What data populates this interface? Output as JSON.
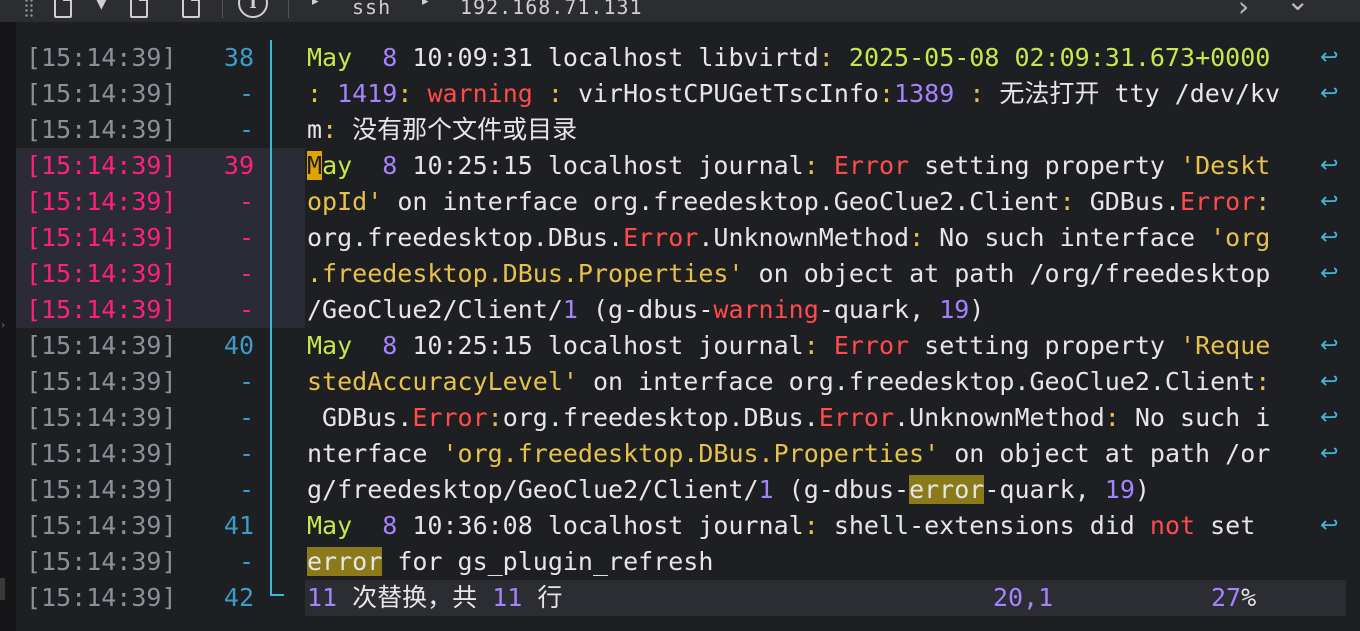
{
  "toolbar": {
    "caret_icon": "triangle-down",
    "info_label": "i",
    "path_arrow_1": "▸",
    "path_seg_1": "ssh",
    "path_arrow_2": "▸",
    "path_seg_2": "192.168.71.131",
    "nav_next": "›",
    "nav_menu": "⌄"
  },
  "gutter": [
    {
      "ts": "[15:14:39]",
      "ln": "38",
      "hl": false
    },
    {
      "ts": "[15:14:39]",
      "ln": "-",
      "hl": false
    },
    {
      "ts": "[15:14:39]",
      "ln": "-",
      "hl": false
    },
    {
      "ts": "[15:14:39]",
      "ln": "39",
      "hl": true
    },
    {
      "ts": "[15:14:39]",
      "ln": "-",
      "hl": true
    },
    {
      "ts": "[15:14:39]",
      "ln": "-",
      "hl": true
    },
    {
      "ts": "[15:14:39]",
      "ln": "-",
      "hl": true
    },
    {
      "ts": "[15:14:39]",
      "ln": "-",
      "hl": true
    },
    {
      "ts": "[15:14:39]",
      "ln": "40",
      "hl": false
    },
    {
      "ts": "[15:14:39]",
      "ln": "-",
      "hl": false
    },
    {
      "ts": "[15:14:39]",
      "ln": "-",
      "hl": false
    },
    {
      "ts": "[15:14:39]",
      "ln": "-",
      "hl": false
    },
    {
      "ts": "[15:14:39]",
      "ln": "-",
      "hl": false
    },
    {
      "ts": "[15:14:39]",
      "ln": "41",
      "hl": false
    },
    {
      "ts": "[15:14:39]",
      "ln": "-",
      "hl": false
    },
    {
      "ts": "[15:14:39]",
      "ln": "42",
      "hl": false
    }
  ],
  "lines": [
    {
      "wrap": true,
      "segs": [
        [
          "May",
          "c-month"
        ],
        [
          "  ",
          ""
        ],
        [
          "8",
          "c-num"
        ],
        [
          " 10:09:31 ",
          ""
        ],
        [
          "localhost libvirtd",
          ""
        ],
        [
          ": ",
          "c-str"
        ],
        [
          "2025-05-08 02:09:31.673+0000 ",
          "c-date"
        ]
      ]
    },
    {
      "wrap": true,
      "segs": [
        [
          ": ",
          "c-str"
        ],
        [
          "1419",
          "c-num"
        ],
        [
          ": ",
          "c-str"
        ],
        [
          "warning",
          "c-red"
        ],
        [
          " : ",
          "c-str"
        ],
        [
          "virHostCPUGetTscInfo",
          ""
        ],
        [
          ":",
          "c-str"
        ],
        [
          "1389",
          "c-num"
        ],
        [
          " : ",
          "c-str"
        ],
        [
          "无法打开 tty /dev/kv",
          ""
        ]
      ]
    },
    {
      "wrap": false,
      "segs": [
        [
          "m",
          ""
        ],
        [
          ": ",
          "c-str"
        ],
        [
          "没有那个文件或目录",
          ""
        ]
      ]
    },
    {
      "wrap": true,
      "segs": [
        [
          "M",
          "cursor"
        ],
        [
          "ay",
          "c-month"
        ],
        [
          "  ",
          ""
        ],
        [
          "8",
          "c-num"
        ],
        [
          " 10:25:15 localhost journal",
          ""
        ],
        [
          ": ",
          "c-str"
        ],
        [
          "Error",
          "c-red"
        ],
        [
          " setting property ",
          ""
        ],
        [
          "'Deskt",
          "c-str"
        ]
      ]
    },
    {
      "wrap": true,
      "segs": [
        [
          "opId'",
          "c-str"
        ],
        [
          " on interface org.freedesktop.GeoClue2.Client",
          ""
        ],
        [
          ": ",
          "c-str"
        ],
        [
          "GDBus.",
          ""
        ],
        [
          "Error",
          "c-red"
        ],
        [
          ": ",
          "c-str"
        ]
      ]
    },
    {
      "wrap": true,
      "segs": [
        [
          "org.freedesktop.DBus.",
          ""
        ],
        [
          "Error",
          "c-red"
        ],
        [
          ".UnknownMethod",
          ""
        ],
        [
          ": ",
          "c-str"
        ],
        [
          "No such",
          ""
        ],
        [
          " interface ",
          ""
        ],
        [
          "'org",
          "c-str"
        ]
      ]
    },
    {
      "wrap": true,
      "segs": [
        [
          ".freedesktop.DBus.Properties'",
          "c-str"
        ],
        [
          " on object at path /org/freedesktop",
          ""
        ]
      ]
    },
    {
      "wrap": false,
      "segs": [
        [
          "/GeoClue2/Client/",
          ""
        ],
        [
          "1",
          "c-num"
        ],
        [
          " (g-dbus-",
          ""
        ],
        [
          "warning",
          "c-red"
        ],
        [
          "-quark, ",
          ""
        ],
        [
          "19",
          "c-num"
        ],
        [
          ")",
          ""
        ]
      ]
    },
    {
      "wrap": true,
      "segs": [
        [
          "May",
          "c-month"
        ],
        [
          "  ",
          ""
        ],
        [
          "8",
          "c-num"
        ],
        [
          " 10:25:15 localhost journal",
          ""
        ],
        [
          ": ",
          "c-str"
        ],
        [
          "Error",
          "c-red"
        ],
        [
          " setting property ",
          ""
        ],
        [
          "'Reque",
          "c-str"
        ]
      ]
    },
    {
      "wrap": true,
      "segs": [
        [
          "stedAccuracyLevel'",
          "c-str"
        ],
        [
          " on interface org.freedesktop.GeoClue2.Client",
          ""
        ],
        [
          ": ",
          "c-str"
        ]
      ]
    },
    {
      "wrap": true,
      "segs": [
        [
          " GDBus.",
          ""
        ],
        [
          "Error",
          "c-red"
        ],
        [
          ":",
          "c-str"
        ],
        [
          "org.freedesktop.DBus.",
          ""
        ],
        [
          "Error",
          "c-red"
        ],
        [
          ".UnknownMethod",
          ""
        ],
        [
          ": ",
          "c-str"
        ],
        [
          "No such",
          ""
        ],
        [
          " i",
          ""
        ]
      ]
    },
    {
      "wrap": true,
      "segs": [
        [
          "nterface ",
          ""
        ],
        [
          "'org.freedesktop.DBus.Properties'",
          "c-str"
        ],
        [
          " on object at path /or",
          ""
        ]
      ]
    },
    {
      "wrap": false,
      "segs": [
        [
          "g/freedesktop/GeoClue2/Client/",
          ""
        ],
        [
          "1",
          "c-num"
        ],
        [
          " (g-dbus-",
          ""
        ],
        [
          "error",
          "match"
        ],
        [
          "-quark, ",
          ""
        ],
        [
          "19",
          "c-num"
        ],
        [
          ")",
          ""
        ]
      ]
    },
    {
      "wrap": true,
      "segs": [
        [
          "May",
          "c-month"
        ],
        [
          "  ",
          ""
        ],
        [
          "8",
          "c-num"
        ],
        [
          " 10:36:08 localhost journal",
          ""
        ],
        [
          ": ",
          "c-str"
        ],
        [
          "shell-extensions did ",
          ""
        ],
        [
          "not",
          "c-red"
        ],
        [
          " set ",
          ""
        ]
      ]
    },
    {
      "wrap": false,
      "segs": [
        [
          "error",
          "match"
        ],
        [
          " for gs_plugin_refresh",
          ""
        ]
      ]
    }
  ],
  "status": {
    "count_1": "11",
    "text_1": " 次替换，共 ",
    "count_2": "11",
    "text_2": " 行",
    "position": "20,1",
    "percent_value": "27",
    "percent_symbol": "%"
  },
  "colors": {
    "timestamp": "#8a8f98",
    "highlight_pink": "#ff1f7e",
    "line_number": "#3a9cc9",
    "accent_line": "#41b5d6",
    "month": "#c5e84a",
    "number": "#a583ff",
    "error": "#ff4b4b",
    "string": "#e6c24a",
    "match_bg": "#8a7a1a"
  }
}
